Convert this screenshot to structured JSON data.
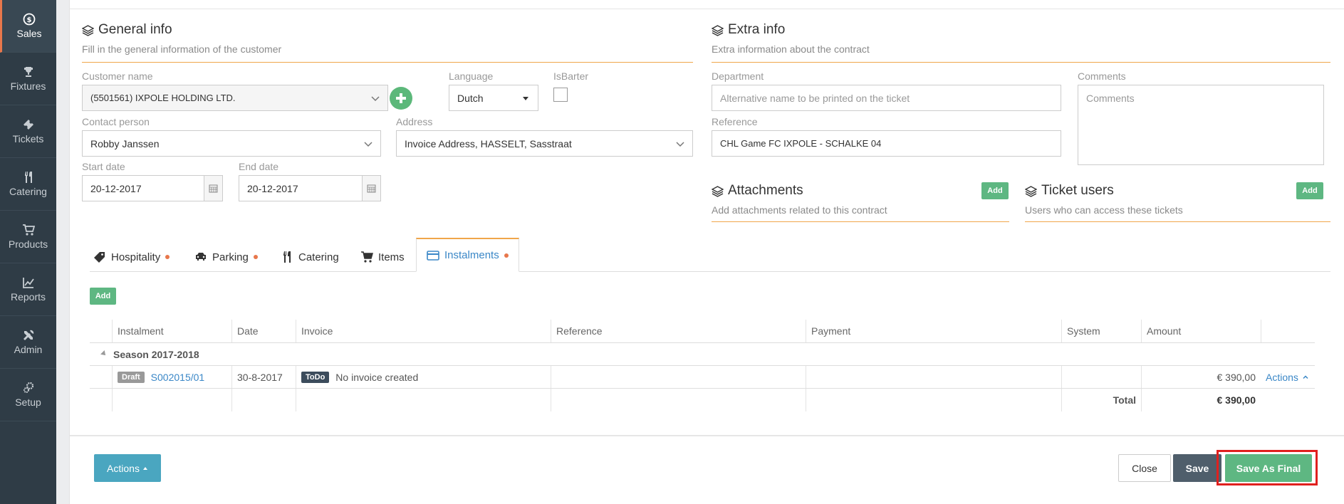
{
  "sidebar": {
    "items": [
      {
        "label": "Sales",
        "icon": "dollar-icon",
        "active": true
      },
      {
        "label": "Fixtures",
        "icon": "trophy-icon"
      },
      {
        "label": "Tickets",
        "icon": "ticket-icon"
      },
      {
        "label": "Catering",
        "icon": "cutlery-icon"
      },
      {
        "label": "Products",
        "icon": "cart-icon"
      },
      {
        "label": "Reports",
        "icon": "chart-icon"
      },
      {
        "label": "Admin",
        "icon": "tools-icon"
      },
      {
        "label": "Setup",
        "icon": "gears-icon"
      }
    ]
  },
  "general": {
    "title": "General info",
    "subtitle": "Fill in the general information of the customer",
    "customer_label": "Customer name",
    "customer_value": "(5501561) IXPOLE HOLDING LTD.",
    "language_label": "Language",
    "language_value": "Dutch",
    "isbarter_label": "IsBarter",
    "contact_label": "Contact person",
    "contact_value": "Robby Janssen",
    "address_label": "Address",
    "address_value": "Invoice Address, HASSELT, Sasstraat",
    "start_label": "Start date",
    "start_value": "20-12-2017",
    "end_label": "End date",
    "end_value": "20-12-2017"
  },
  "extra": {
    "title": "Extra info",
    "subtitle": "Extra information about the contract",
    "department_label": "Department",
    "department_placeholder": "Alternative name to be printed on the ticket",
    "comments_label": "Comments",
    "comments_placeholder": "Comments",
    "reference_label": "Reference",
    "reference_value": "CHL Game FC IXPOLE - SCHALKE 04"
  },
  "attachments": {
    "title": "Attachments",
    "subtitle": "Add attachments related to this contract",
    "add_label": "Add"
  },
  "ticket_users": {
    "title": "Ticket users",
    "subtitle": "Users who can access these tickets",
    "add_label": "Add"
  },
  "tabs": [
    {
      "label": "Hospitality",
      "dot": true
    },
    {
      "label": "Parking",
      "dot": true
    },
    {
      "label": "Catering",
      "dot": false
    },
    {
      "label": "Items",
      "dot": false
    },
    {
      "label": "Instalments",
      "dot": true,
      "active": true
    }
  ],
  "instalments": {
    "add_label": "Add",
    "columns": [
      "Instalment",
      "Date",
      "Invoice",
      "Reference",
      "Payment",
      "System",
      "Amount"
    ],
    "group": "Season 2017-2018",
    "row": {
      "status": "Draft",
      "instalment": "S002015/01",
      "date": "30-8-2017",
      "invoice_badge": "ToDo",
      "invoice_text": "No invoice created",
      "amount": "€ 390,00",
      "actions": "Actions"
    },
    "total_label": "Total",
    "total_value": "€ 390,00"
  },
  "footer": {
    "actions_label": "Actions",
    "close_label": "Close",
    "save_label": "Save",
    "final_label": "Save As Final"
  }
}
